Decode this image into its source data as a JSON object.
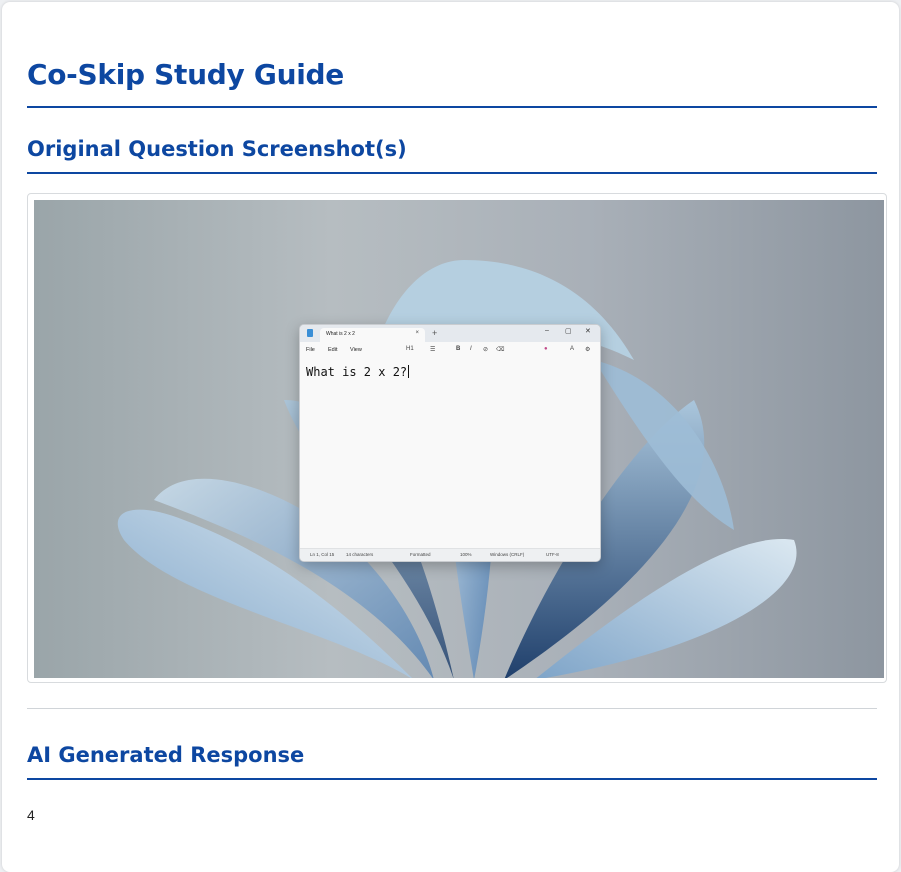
{
  "page": {
    "title": "Co-Skip Study Guide",
    "screenshot_heading": "Original Question Screenshot(s)",
    "response_heading": "AI Generated Response",
    "response_text": "4"
  },
  "notepad": {
    "tab_title": "What is 2 x 2",
    "tab_close": "×",
    "new_tab": "+",
    "window_controls": {
      "minimize": "–",
      "maximize": "▢",
      "close": "✕"
    },
    "menus": [
      "File",
      "Edit",
      "View"
    ],
    "toolbar": {
      "heading": "H1",
      "list": "☰",
      "bold": "B",
      "italic": "I",
      "link": "⊘",
      "clear": "⌫",
      "account": "A",
      "settings": "⚙"
    },
    "body_text": "What is 2 x 2?",
    "status": {
      "position": "Ln 1, Col 15",
      "characters": "14 characters",
      "format": "Formatted",
      "zoom": "100%",
      "line_endings": "Windows (CRLF)",
      "encoding": "UTF-8"
    }
  },
  "colors": {
    "heading": "#0d47a1",
    "rule": "#0d47a1"
  }
}
